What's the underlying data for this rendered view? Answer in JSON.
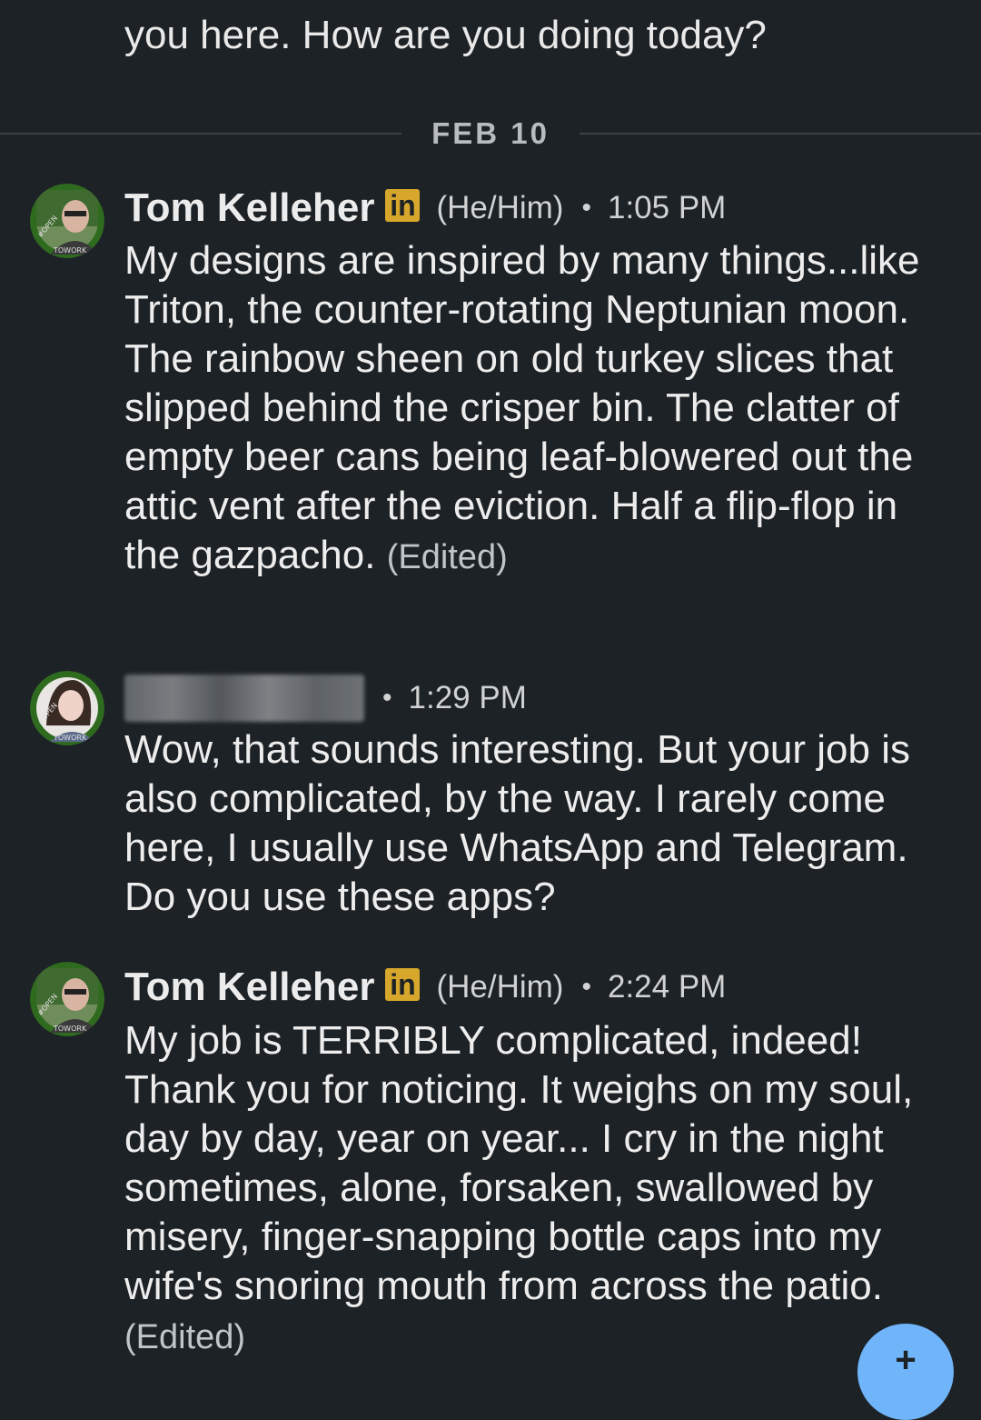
{
  "previous_message": {
    "text": "you here. How are you doing today?"
  },
  "date_separator": "FEB 10",
  "messages": [
    {
      "sender": "Tom Kelleher",
      "badge": "in",
      "pronouns": "(He/Him)",
      "separator": "•",
      "time": "1:05 PM",
      "avatar_icon": "profile-photo-opentowork",
      "body": "My designs are inspired by many things...like Triton, the counter-rotating Neptunian moon.  The rainbow sheen on old turkey slices that slipped behind the crisper bin.  The clatter of empty beer cans being leaf-blowered out the attic vent after the eviction.  Half a flip-flop in the gazpacho.",
      "edited": "(Edited)"
    },
    {
      "sender_blurred": true,
      "separator": "•",
      "time": "1:29 PM",
      "avatar_icon": "profile-photo-opentowork",
      "body": "Wow, that sounds interesting. But your job is also complicated, by the way. I rarely come here, I usually use WhatsApp and Telegram. Do you use these apps?"
    },
    {
      "sender": "Tom Kelleher",
      "badge": "in",
      "pronouns": "(He/Him)",
      "separator": "•",
      "time": "2:24 PM",
      "avatar_icon": "profile-photo-opentowork",
      "body": "My job is TERRIBLY complicated, indeed! Thank you for noticing.  It weighs on my soul, day by day, year on year... I cry in the night sometimes, alone, forsaken, swallowed by misery, finger-snapping bottle caps into my wife's snoring mouth from across the patio.",
      "edited": "(Edited)"
    }
  ],
  "fab": {
    "icon": "plus-icon",
    "glyph": "+",
    "color": "#70b5f9"
  },
  "colors": {
    "background": "#1d2226",
    "linkedin_badge": "#d7a72b",
    "open_to_work_ring": "#2f6b1f"
  }
}
